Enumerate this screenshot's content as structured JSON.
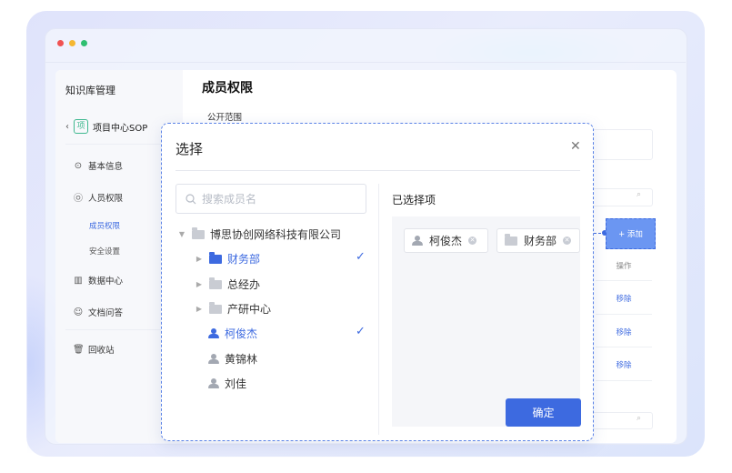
{
  "colors": {
    "accent": "#3d6ae0",
    "dot_red": "#f05252",
    "dot_yellow": "#f5b731",
    "dot_green": "#2fbf71",
    "badge_green": "#3fb88f"
  },
  "sidebar": {
    "title": "知识库管理",
    "back_icon": "chevron-left-icon",
    "project_badge": "项",
    "project_name": "项目中心SOP",
    "menu": [
      {
        "label": "基本信息",
        "icon": "info-icon"
      },
      {
        "label": "人员权限",
        "icon": "user-icon"
      },
      {
        "label": "数据中心",
        "icon": "chart-icon"
      },
      {
        "label": "文档问答",
        "icon": "chat-icon"
      },
      {
        "label": "回收站",
        "icon": "trash-icon"
      }
    ],
    "submenu": [
      {
        "label": "成员权限",
        "active": true
      },
      {
        "label": "安全设置",
        "active": false
      }
    ]
  },
  "main": {
    "title": "成员权限",
    "scope_label": "公开范围",
    "add_button": "+ 添加",
    "column_action": "操作",
    "remove_label": "移除"
  },
  "dialog": {
    "title": "选择",
    "close_icon": "close-icon",
    "search_placeholder": "搜索成员名",
    "selected_title": "已选择项",
    "confirm_button": "确定",
    "tree": [
      {
        "label": "博思协创网络科技有限公司",
        "type": "folder",
        "expanded": true,
        "selected": false
      },
      {
        "label": "财务部",
        "type": "folder",
        "expanded": false,
        "selected": true
      },
      {
        "label": "总经办",
        "type": "folder",
        "expanded": false,
        "selected": false
      },
      {
        "label": "产研中心",
        "type": "folder",
        "expanded": false,
        "selected": false
      },
      {
        "label": "柯俊杰",
        "type": "person",
        "selected": true
      },
      {
        "label": "黄锦林",
        "type": "person",
        "selected": false
      },
      {
        "label": "刘佳",
        "type": "person",
        "selected": false
      }
    ],
    "selected": [
      {
        "label": "柯俊杰",
        "type": "person"
      },
      {
        "label": "财务部",
        "type": "folder"
      }
    ]
  }
}
